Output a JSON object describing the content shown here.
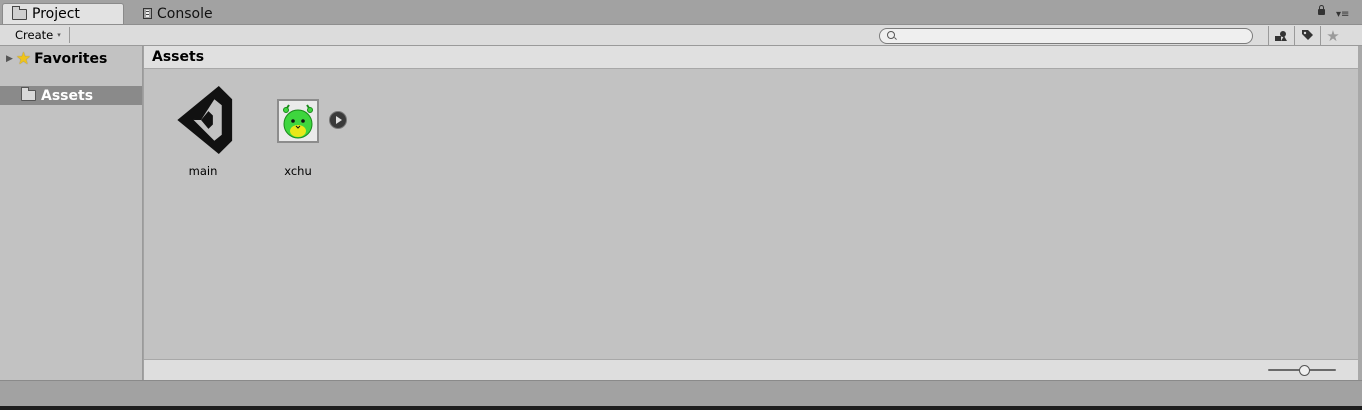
{
  "tabs": [
    {
      "label": "Project",
      "icon": "folder-icon",
      "active": true
    },
    {
      "label": "Console",
      "icon": "console-icon",
      "active": false
    }
  ],
  "window_controls": {
    "lock_icon": "lock-icon",
    "menu_glyph": "▾≡"
  },
  "toolbar": {
    "create_label": "Create",
    "create_arrow": "▾",
    "search": {
      "value": "",
      "placeholder": ""
    },
    "buttons": [
      {
        "name": "filter-by-type",
        "icon": "shapes-icon",
        "glyph": "◆"
      },
      {
        "name": "filter-by-label",
        "icon": "tag-icon",
        "glyph": "◈"
      },
      {
        "name": "favorite",
        "icon": "star-icon",
        "glyph": "★"
      }
    ]
  },
  "sidebar": {
    "favorites": {
      "label": "Favorites",
      "expander": "▶",
      "icon": "star-icon"
    },
    "assets": {
      "label": "Assets",
      "selected": true,
      "icon": "folder-icon"
    }
  },
  "main": {
    "breadcrumb": "Assets",
    "assets": [
      {
        "label": "main",
        "icon": "unity-logo-icon",
        "type": "scene"
      },
      {
        "label": "xchu",
        "icon": "xchu-sprite-icon",
        "type": "texture",
        "expandable": true
      }
    ],
    "zoom_level": 0.55
  },
  "colors": {
    "selection": "#8a8a8a",
    "panel": "#c2c2c2",
    "toolbar": "#dcdcdc",
    "star": "#f0c419",
    "xchu_green": "#3ed63e"
  }
}
